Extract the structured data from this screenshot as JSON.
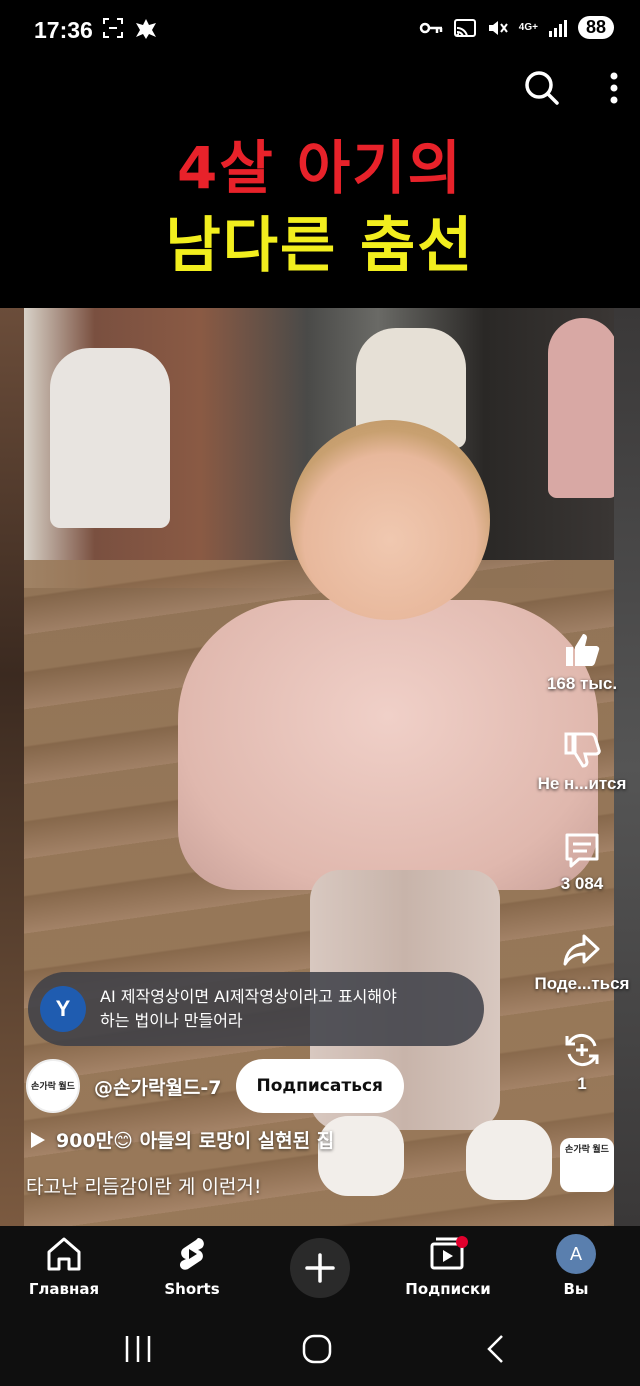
{
  "status_bar": {
    "time": "17:36",
    "network": "4G+",
    "battery": "88"
  },
  "video": {
    "title_line1": "4살 아기의",
    "title_line2": "남다른 춤선",
    "title_colors": {
      "line1": "#e8222a",
      "line2": "#f2ee1e"
    }
  },
  "actions": {
    "like_count": "168 тыс.",
    "dislike_label": "Не н...ится",
    "comments_count": "3 084",
    "share_label": "Поде...ться",
    "remix_count": "1"
  },
  "comment": {
    "avatar_letter": "Y",
    "text_line1": "AI 제작영상이면 AI제작영상이라고 표시해야",
    "text_line2": "하는 법이나 만들어라"
  },
  "channel": {
    "avatar_text": "손가락 월드",
    "name": "@손가락월드-7",
    "subscribe_label": "Подписаться"
  },
  "playlist": {
    "text": "900만😊 아들의 로망이 실현된 집"
  },
  "description": "타고난 리듬감이란 게 이런거!",
  "sound_thumb_text": "손가락 월드",
  "bottom_nav": {
    "home": "Главная",
    "shorts": "Shorts",
    "subscriptions": "Подписки",
    "you": "Вы",
    "you_avatar_letter": "A"
  }
}
